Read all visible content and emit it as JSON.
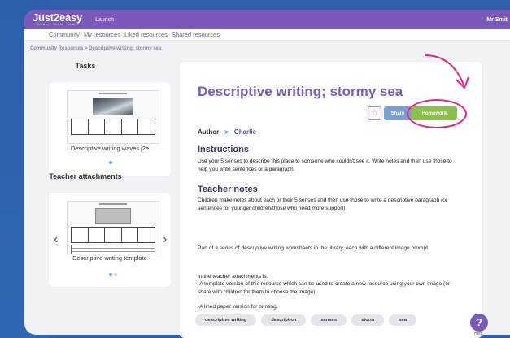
{
  "topbar": {
    "logo": "Just2easy",
    "logo_tagline": "Create · Share · Learn",
    "launch": "Launch",
    "user": "Mr Smit"
  },
  "subnav": [
    "Community",
    "My resources",
    "Liked resources",
    "Shared resources"
  ],
  "breadcrumb": "Community Resources > Descriptive writing; stormy sea",
  "tasks": {
    "title": "Tasks",
    "caption": "Descriptive writing waves j2e"
  },
  "attachments": {
    "title": "Teacher attachments",
    "caption": "Descriptive writing template"
  },
  "resource": {
    "title": "Descriptive writing; stormy sea",
    "share_label": "Share",
    "homework_label": "Homework",
    "author_label": "Author",
    "author_name": "Charlie",
    "instructions_heading": "Instructions",
    "instructions_text": "Use your 5 senses to describe this place to someone who couldn't see it. Write notes and then use those to help you write sentences or a paragraph.",
    "notes_heading": "Teacher notes",
    "notes_p1": "Children make notes about each or their 5 senses and then use those to write a descriptive paragraph (or sentences for younger children/those who need more support).",
    "notes_p2": "Part of a series of descriptive writing worksheets in the library, each with a different image prompt.",
    "notes_p3": "In the teacher attachments is:",
    "notes_p4": "-A template version of this resource which can be used to create a new resource using your own image (or share with children for them to choose the image).",
    "notes_p5": "-A lined paper version for printing."
  },
  "tags": [
    "descriptive writing",
    "description",
    "senses",
    "storm",
    "sea"
  ],
  "help": {
    "symbol": "?",
    "label": "Help"
  },
  "colors": {
    "accent": "#7a5ab8",
    "homework": "#8cc04e",
    "share": "#7d9fcf",
    "annotation": "#e0258a"
  }
}
